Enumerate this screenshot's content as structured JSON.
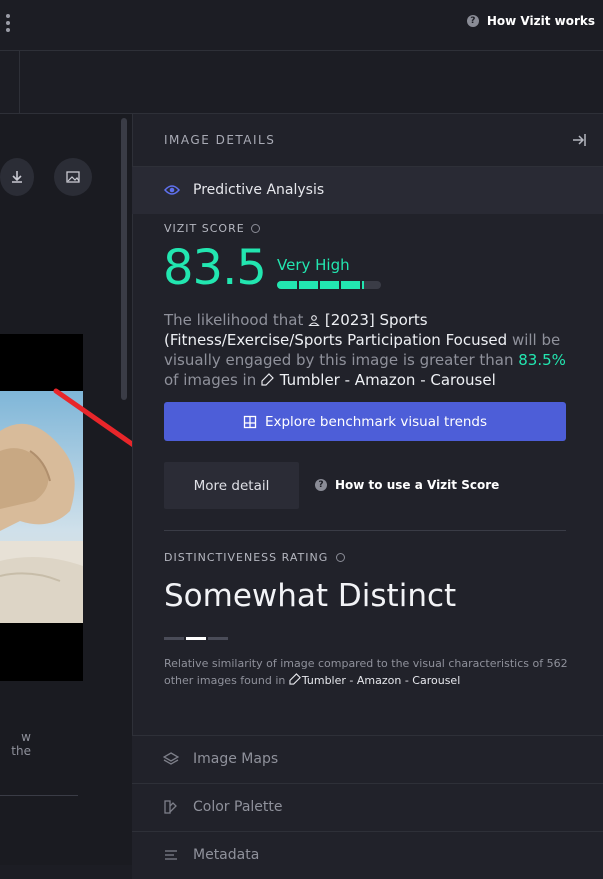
{
  "header": {
    "help_label": "How Vizit works"
  },
  "left": {
    "note_text": "w the"
  },
  "panel": {
    "title": "IMAGE DETAILS",
    "predictive_label": "Predictive Analysis",
    "score_label": "VIZIT SCORE",
    "score_value": "83.5",
    "score_level": "Very High",
    "score_fraction": 0.835,
    "desc": {
      "p1": "The likelihood that ",
      "audience": "[2023] Sports (Fitness/Exercise/Sports Participation Focused",
      "p2": " will be visually engaged by this image is greater than ",
      "pct": "83.5%",
      "p3": " of images in ",
      "benchmark": "Tumbler - Amazon - Carousel"
    },
    "explore_label": "Explore benchmark visual trends",
    "more_detail_label": "More detail",
    "howto_label": "How to use a Vizit Score",
    "distinct_label": "DISTINCTIVENESS RATING",
    "distinct_value": "Somewhat Distinct",
    "distinct_note": {
      "p1": "Relative similarity of image compared to the visual characteristics of 562 other images found in ",
      "benchmark": "Tumbler - Amazon - Carousel"
    },
    "sections": [
      "Image Maps",
      "Color Palette",
      "Metadata"
    ]
  },
  "colors": {
    "accent": "#22e6b0",
    "button": "#4d5ed8",
    "arrow": "#e8262a"
  },
  "icons": [
    "kebab-icon",
    "help-icon",
    "download-icon",
    "image-icon",
    "collapse-panel-icon",
    "eye-icon",
    "person-icon",
    "tag-icon",
    "chart-book-icon",
    "layers-icon",
    "palette-icon",
    "list-icon"
  ]
}
